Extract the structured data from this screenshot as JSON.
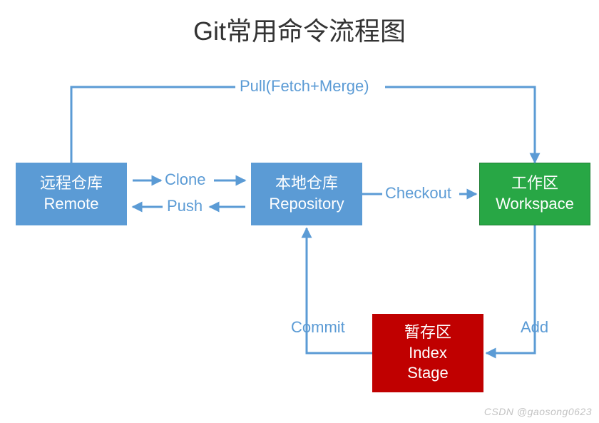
{
  "title": "Git常用命令流程图",
  "nodes": {
    "remote": {
      "line1": "远程仓库",
      "line2": "Remote"
    },
    "repository": {
      "line1": "本地仓库",
      "line2": "Repository"
    },
    "workspace": {
      "line1": "工作区",
      "line2": "Workspace"
    },
    "index": {
      "line1": "暂存区",
      "line2": "Index",
      "line3": "Stage"
    }
  },
  "edges": {
    "pull": "Pull(Fetch+Merge)",
    "clone": "Clone",
    "push": "Push",
    "checkout": "Checkout",
    "commit": "Commit",
    "add": "Add"
  },
  "colors": {
    "blue": "#5b9bd5",
    "green": "#28a745",
    "red": "#c00000"
  },
  "watermark": "CSDN @gaosong0623"
}
